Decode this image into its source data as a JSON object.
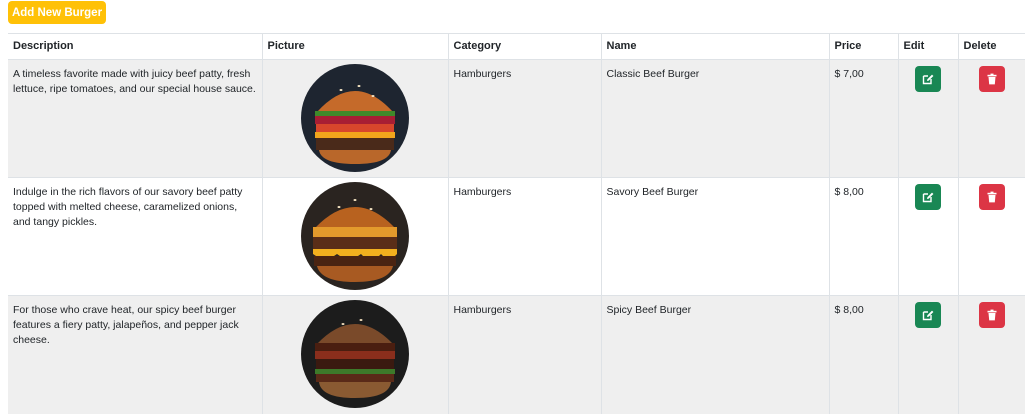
{
  "toolbar": {
    "add_label": "Add New Burger"
  },
  "table": {
    "headers": {
      "description": "Description",
      "picture": "Picture",
      "category": "Category",
      "name": "Name",
      "price": "Price",
      "edit": "Edit",
      "delete": "Delete"
    },
    "rows": [
      {
        "description": "A timeless favorite made with juicy beef patty, fresh lettuce, ripe tomatoes, and our special house sauce.",
        "category": "Hamburgers",
        "name": "Classic Beef Burger",
        "price": "$ 7,00"
      },
      {
        "description": "Indulge in the rich flavors of our savory beef patty topped with melted cheese, caramelized onions, and tangy pickles.",
        "category": "Hamburgers",
        "name": "Savory Beef Burger",
        "price": "$ 8,00"
      },
      {
        "description": "For those who crave heat, our spicy beef burger features a fiery patty, jalapeños, and pepper jack cheese.",
        "category": "Hamburgers",
        "name": "Spicy Beef Burger",
        "price": "$ 8,00"
      }
    ]
  },
  "colors": {
    "add": "#ffc107",
    "edit": "#198754",
    "delete": "#dc3545",
    "row_alt": "#efefef"
  },
  "icons": {
    "edit": "edit-icon",
    "delete": "trash-icon"
  }
}
